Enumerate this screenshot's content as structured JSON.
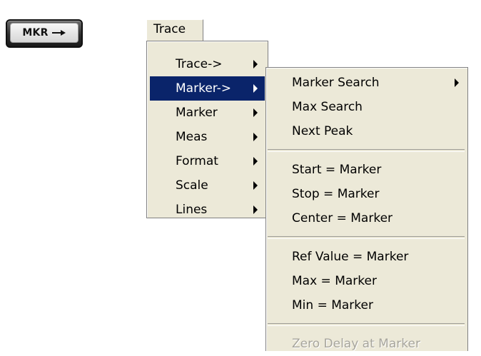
{
  "hardkey": {
    "label": "MKR",
    "icon": "right-arrow-icon"
  },
  "menubar": {
    "trace_label": "Trace"
  },
  "main_menu": {
    "items": [
      {
        "label": "Trace->",
        "submenu": true
      },
      {
        "label": "Marker->",
        "submenu": true,
        "selected": true
      },
      {
        "label": "Marker",
        "submenu": true
      },
      {
        "label": "Meas",
        "submenu": true
      },
      {
        "label": "Format",
        "submenu": true
      },
      {
        "label": "Scale",
        "submenu": true
      },
      {
        "label": "Lines",
        "submenu": true
      }
    ]
  },
  "sub_menu": {
    "items": [
      {
        "label": "Marker Search",
        "submenu": true
      },
      {
        "label": "Max Search"
      },
      {
        "label": "Next Peak"
      },
      {
        "label": "Start = Marker"
      },
      {
        "label": "Stop = Marker"
      },
      {
        "label": "Center = Marker"
      },
      {
        "label": "Ref Value = Marker"
      },
      {
        "label": "Max = Marker"
      },
      {
        "label": "Min = Marker"
      },
      {
        "label": "Zero Delay at Marker",
        "disabled": true
      }
    ]
  },
  "colors": {
    "menu_background": "#ece9d8",
    "selection": "#0a246a",
    "disabled_text": "#a7a59c"
  }
}
